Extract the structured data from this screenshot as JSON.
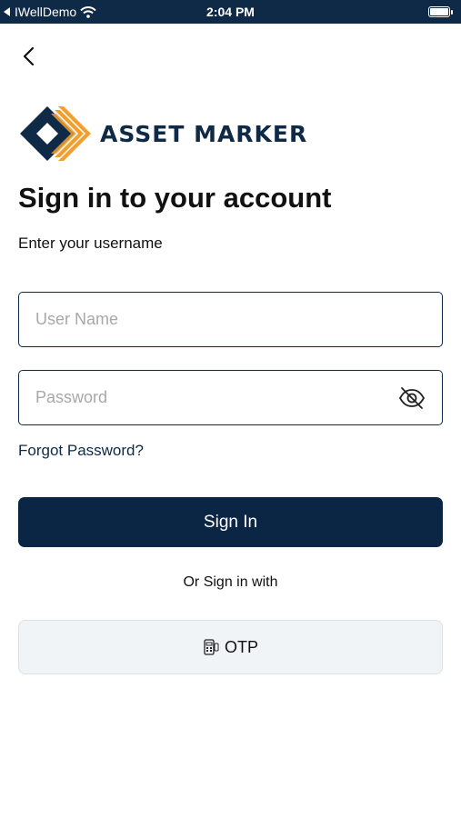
{
  "status_bar": {
    "carrier": "IWellDemo",
    "time": "2:04 PM"
  },
  "header": {
    "back_icon": "chevron-left-icon"
  },
  "logo": {
    "text": "ASSET MARKER",
    "colors": {
      "navy": "#0f2a47",
      "orange": "#f0a030"
    }
  },
  "form": {
    "title": "Sign in to your account",
    "subtitle": "Enter your username",
    "username": {
      "placeholder": "User Name",
      "value": ""
    },
    "password": {
      "placeholder": "Password",
      "value": "",
      "toggle_icon": "eye-off-icon"
    },
    "forgot_label": "Forgot Password?",
    "signin_label": "Sign In",
    "alt_label": "Or Sign in with",
    "otp_label": "OTP",
    "otp_icon": "otp-device-icon"
  },
  "colors": {
    "primary": "#0b2645",
    "status_bar": "#0f2a47",
    "secondary_button_bg": "#f1f4f7"
  }
}
